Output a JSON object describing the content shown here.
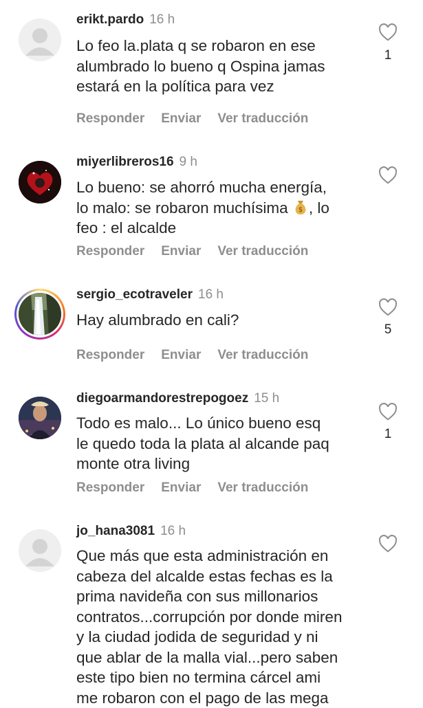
{
  "actions": {
    "reply": "Responder",
    "send": "Enviar",
    "translate": "Ver traducción"
  },
  "comments": [
    {
      "username": "erikt.pardo",
      "time": "16 h",
      "text": "Lo feo la.plata q se robaron en ese\nalumbrado lo bueno q Ospina jamas\nestará en la política para vez",
      "likes": "1",
      "avatar": "default-avatar"
    },
    {
      "username": "miyerlibreros16",
      "time": "9 h",
      "text_before_emoji": "Lo bueno: se ahorró mucha energía,\nlo malo: se robaron muchísima ",
      "emoji": "money-bag-emoji",
      "text_after_emoji": ", lo\nfeo : el alcalde",
      "likes": "",
      "avatar": "red-dark-photo-avatar"
    },
    {
      "username": "sergio_ecotraveler",
      "time": "16 h",
      "text": "Hay alumbrado en cali?",
      "likes": "5",
      "avatar": "waterfall-photo-avatar"
    },
    {
      "username": "diegoarmandorestrepogoez",
      "time": "15 h",
      "text": "Todo es malo... Lo único bueno esq\nle quedo toda la plata al alcande paq\nmonte otra living",
      "likes": "1",
      "avatar": "man-photo-avatar"
    },
    {
      "username": "jo_hana3081",
      "time": "16 h",
      "text": "Que más que esta administración en\ncabeza del alcalde estas fechas es la\nprima navideña con sus millonarios\ncontratos...corrupción por donde miren\ny la ciudad jodida de seguridad y ni\nque ablar de la malla vial...pero saben\neste tipo bien no termina cárcel ami\nme robaron con el pago de las mega",
      "likes": "",
      "avatar": "default-avatar"
    }
  ]
}
